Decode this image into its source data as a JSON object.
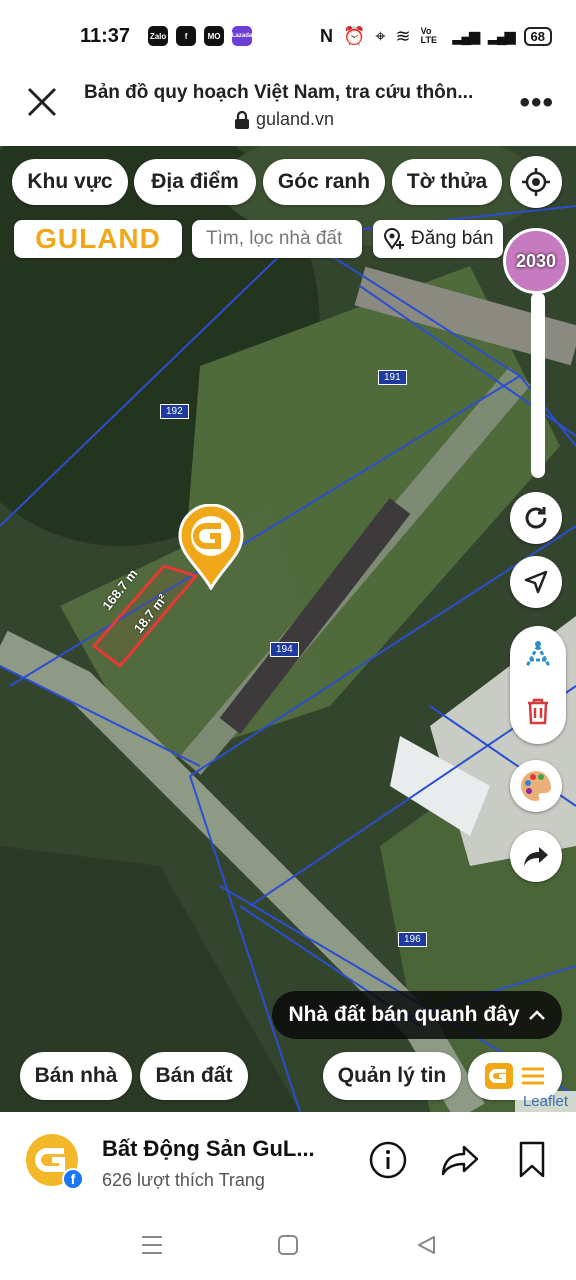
{
  "status": {
    "time": "11:37",
    "apps": [
      "Zalo",
      "f",
      "MO",
      "Lazada"
    ],
    "network": "Vo LTE",
    "battery": "68"
  },
  "browser": {
    "title": "Bản đồ quy hoạch Việt Nam, tra cứu thôn...",
    "url": "guland.vn"
  },
  "map": {
    "chips": {
      "area": "Khu vực",
      "place": "Địa điểm",
      "corner": "Góc ranh",
      "plot": "Tờ thửa"
    },
    "logo": "GULAND",
    "search_placeholder": "Tìm, lọc nhà đất",
    "post_label": "Đăng bán",
    "year_label": "2030",
    "parcel_labels": [
      "191",
      "192",
      "194",
      "196"
    ],
    "dimension_a": "168.7 m",
    "dimension_b": "18.7 m²",
    "nearby_label": "Nhà đất bán quanh đây",
    "bottom_chips": {
      "sell_house": "Bán nhà",
      "sell_land": "Bán đất",
      "manage": "Quản lý tin"
    },
    "attribution": "Leaflet"
  },
  "facebook": {
    "page_name": "Bất Động Sản GuL...",
    "likes": "626 lượt thích Trang"
  },
  "colors": {
    "brand": "#f0a818",
    "parcel_line": "#2b4fd0",
    "selected_parcel": "#e53935"
  }
}
